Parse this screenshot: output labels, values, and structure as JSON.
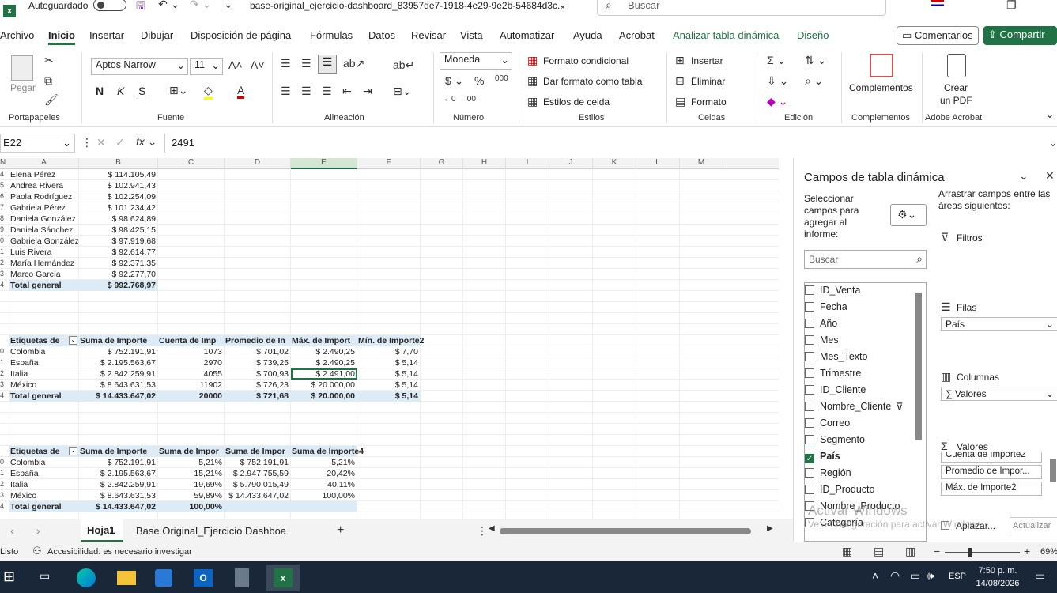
{
  "titlebar": {
    "autosave": "Autoguardado",
    "filename": "base-original_ejercicio-dashboard_83957de7-1918-4e29-9e2b-54684d3c...",
    "search_placeholder": "Buscar"
  },
  "tabs": [
    "Archivo",
    "Inicio",
    "Insertar",
    "Dibujar",
    "Disposición de página",
    "Fórmulas",
    "Datos",
    "Revisar",
    "Vista",
    "Automatizar",
    "Ayuda",
    "Acrobat",
    "Analizar tabla dinámica",
    "Diseño"
  ],
  "actions": {
    "comments": "Comentarios",
    "share": "Compartir"
  },
  "ribbon": {
    "paste": "Pegar",
    "font_name": "Aptos Narrow",
    "font_size": "11",
    "number_format": "Moneda",
    "cond_format": "Formato condicional",
    "table_format": "Dar formato como tabla",
    "cell_styles": "Estilos de celda",
    "insert": "Insertar",
    "delete": "Eliminar",
    "format": "Formato",
    "addins": "Complementos",
    "create_pdf_1": "Crear",
    "create_pdf_2": "un PDF",
    "groups": {
      "clipboard": "Portapapeles",
      "font": "Fuente",
      "alignment": "Alineación",
      "number": "Número",
      "styles": "Estilos",
      "cells": "Celdas",
      "editing": "Edición",
      "addins": "Complementos",
      "acrobat": "Adobe Acrobat"
    },
    "bold": "N",
    "italic": "K",
    "underline": "S"
  },
  "formula_bar": {
    "cell_ref": "E22",
    "value": "2491"
  },
  "columns": [
    "A",
    "B",
    "C",
    "D",
    "E",
    "F",
    "G",
    "H",
    "I",
    "J",
    "K",
    "L",
    "M",
    "N"
  ],
  "table1": {
    "rows": [
      [
        "4",
        "Elena Pérez",
        "$ 114.105,49"
      ],
      [
        "5",
        "Andrea Rivera",
        "$ 102.941,43"
      ],
      [
        "6",
        "Paola Rodríguez",
        "$ 102.254,09"
      ],
      [
        "7",
        "Gabriela Pérez",
        "$ 101.234,42"
      ],
      [
        "8",
        "Daniela González",
        "$ 98.624,89"
      ],
      [
        "9",
        "Daniela Sánchez",
        "$ 98.425,15"
      ],
      [
        "0",
        "Gabriela González",
        "$ 97.919,68"
      ],
      [
        "1",
        "Luis Rivera",
        "$ 92.614,77"
      ],
      [
        "2",
        "María Hernández",
        "$ 92.371,35"
      ],
      [
        "3",
        "Marco García",
        "$ 92.277,70"
      ]
    ],
    "total_num": "4",
    "total_label": "Total general",
    "total_value": "$ 992.768,97"
  },
  "table2": {
    "headers": [
      "Etiquetas de",
      "Suma de Importe",
      "Cuenta de Imp",
      "Promedio de In",
      "Máx. de Import",
      "Mín. de Importe2"
    ],
    "rows": [
      [
        "0",
        "Colombia",
        "$ 752.191,91",
        "1073",
        "$ 701,02",
        "$ 2.490,25",
        "$ 7,70"
      ],
      [
        "1",
        "España",
        "$ 2.195.563,67",
        "2970",
        "$ 739,25",
        "$ 2.490,25",
        "$ 5,14"
      ],
      [
        "2",
        "Italia",
        "$ 2.842.259,91",
        "4055",
        "$ 700,93",
        "$ 2.491,00",
        "$ 5,14"
      ],
      [
        "3",
        "México",
        "$ 8.643.631,53",
        "11902",
        "$ 726,23",
        "$ 20.000,00",
        "$ 5,14"
      ]
    ],
    "total": [
      "4",
      "Total general",
      "$ 14.433.647,02",
      "20000",
      "$ 721,68",
      "$ 20.000,00",
      "$ 5,14"
    ]
  },
  "table3": {
    "headers": [
      "Etiquetas de",
      "Suma de Importe",
      "Suma de Impor",
      "Suma de Impor",
      "Suma de Importe4"
    ],
    "rows": [
      [
        "0",
        "Colombia",
        "$ 752.191,91",
        "5,21%",
        "$ 752.191,91",
        "5,21%"
      ],
      [
        "1",
        "España",
        "$ 2.195.563,67",
        "15,21%",
        "$ 2.947.755,59",
        "20,42%"
      ],
      [
        "2",
        "Italia",
        "$ 2.842.259,91",
        "19,69%",
        "$ 5.790.015,49",
        "40,11%"
      ],
      [
        "3",
        "México",
        "$ 8.643.631,53",
        "59,89%",
        "$ 14.433.647,02",
        "100,00%"
      ]
    ],
    "total": [
      "4",
      "Total general",
      "$ 14.433.647,02",
      "100,00%"
    ]
  },
  "panel": {
    "title": "Campos de tabla dinámica",
    "select_label": "Seleccionar campos para agregar al informe:",
    "drag_label": "Arrastrar campos entre las áreas siguientes:",
    "search_placeholder": "Buscar",
    "filters": "Filtros",
    "rows": "Filas",
    "columns": "Columnas",
    "values": "Valores",
    "rows_value": "País",
    "columns_value": "∑ Valores",
    "value_items": [
      "Cuenta de Importe2",
      "Promedio de Impor...",
      "Máx. de Importe2"
    ],
    "defer": "Aplazar...",
    "update": "Actualizar",
    "fields": [
      {
        "name": "ID_Venta",
        "checked": false
      },
      {
        "name": "Fecha",
        "checked": false
      },
      {
        "name": "Año",
        "checked": false
      },
      {
        "name": "Mes",
        "checked": false
      },
      {
        "name": "Mes_Texto",
        "checked": false
      },
      {
        "name": "Trimestre",
        "checked": false
      },
      {
        "name": "ID_Cliente",
        "checked": false
      },
      {
        "name": "Nombre_Cliente",
        "checked": false
      },
      {
        "name": "Correo",
        "checked": false
      },
      {
        "name": "Segmento",
        "checked": false
      },
      {
        "name": "País",
        "checked": true
      },
      {
        "name": "Región",
        "checked": false
      },
      {
        "name": "ID_Producto",
        "checked": false
      },
      {
        "name": "Nombre_Producto",
        "checked": false
      },
      {
        "name": "Categoría",
        "checked": false
      }
    ]
  },
  "sheet_tabs": [
    "Hoja1",
    "Base Original_Ejercicio Dashboa"
  ],
  "status": {
    "ready": "Listo",
    "accessibility": "Accesibilidad: es necesario investigar",
    "zoom": "69%"
  },
  "watermark": {
    "line1": "Activar Windows",
    "line2": "Ve a Configuración para activar Windows."
  },
  "taskbar": {
    "lang": "ESP",
    "time": "7:50 p. m.",
    "date": "14/08/2026"
  }
}
